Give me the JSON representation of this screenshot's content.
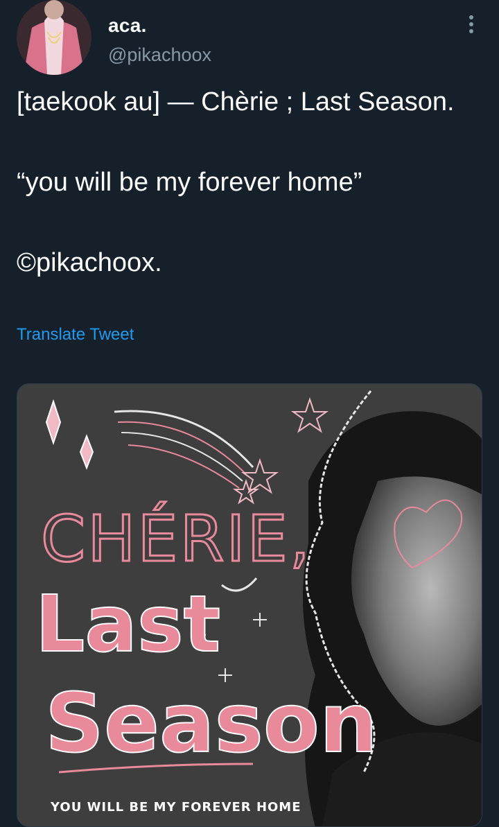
{
  "tweet": {
    "display_name": "aca.",
    "handle": "@pikachoox",
    "text": "[taekook au] — Chèrie ; Last Season.\n\n“you will be my forever home”\n\n©pikachoox.",
    "translate_label": "Translate Tweet",
    "more_icon": "more-vertical-icon",
    "avatar_icon": "avatar"
  },
  "media": {
    "title_line1": "CHÉRIE,",
    "title_line2": "Last",
    "title_line3": "Season",
    "tagline": "YOU WILL BE MY FOREVER HOME"
  },
  "colors": {
    "background": "#15202b",
    "text": "#ffffff",
    "secondary": "#8899a6",
    "link": "#1d9bf0",
    "cover_pink": "#e98a9b"
  }
}
